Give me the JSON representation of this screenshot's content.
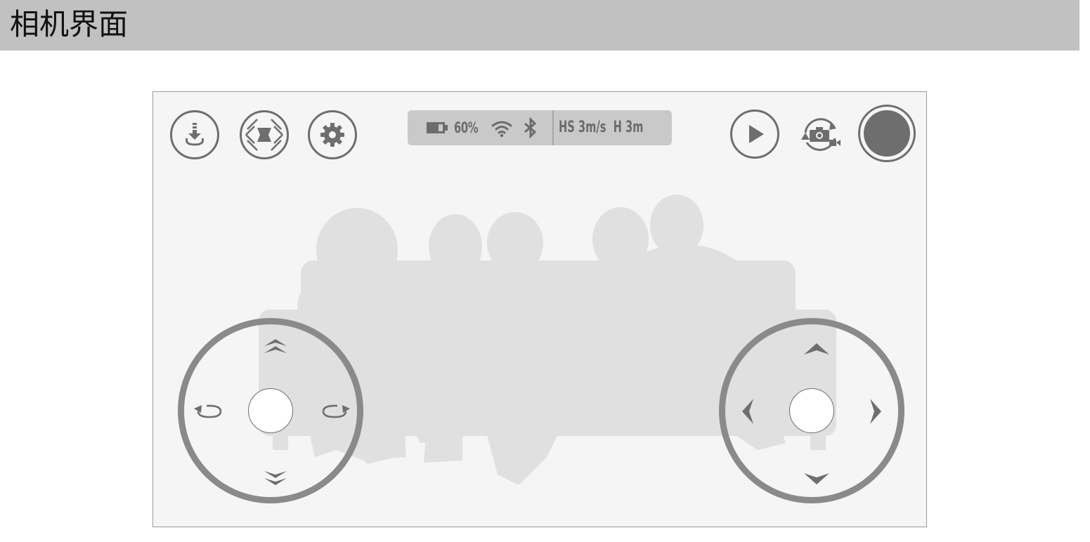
{
  "header": {
    "title": "相机界面"
  },
  "toolbar_left": [
    {
      "name": "takeoff-land-button",
      "icon": "takeoff-download-icon"
    },
    {
      "name": "flight-mode-button",
      "icon": "drone-icon"
    },
    {
      "name": "settings-button",
      "icon": "gear-icon"
    }
  ],
  "status": {
    "battery": "60%",
    "wifi_icon": "wifi-icon",
    "bluetooth_icon": "bluetooth-icon",
    "speed_height": "HS 3m/s  H 3m"
  },
  "toolbar_right": [
    {
      "name": "playback-button",
      "icon": "play-icon"
    },
    {
      "name": "photo-video-switch-button",
      "icon": "camera-switch-icon"
    },
    {
      "name": "shutter-button",
      "icon": "shutter-icon"
    }
  ],
  "left_joystick": {
    "controls": [
      "ascend-icon",
      "rotate-left-icon",
      "rotate-right-icon",
      "descend-icon"
    ]
  },
  "right_joystick": {
    "controls": [
      "forward-icon",
      "left-icon",
      "right-icon",
      "backward-icon"
    ]
  },
  "colors": {
    "header_bg": "#c0c1c0",
    "viewport_bg": "#f5f5f5",
    "icon_gray": "#6e6e6e",
    "joystick_ring": "#8a8a8a",
    "silhouette": "#e0e0e0",
    "status_bg": "#c9c9c9"
  }
}
